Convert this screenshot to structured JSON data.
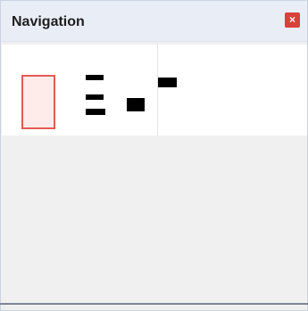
{
  "panel": {
    "title": "Navigation",
    "close_icon_glyph": "×",
    "accent_color": "#d9413b",
    "viewport_frame_color": "#e55a55"
  },
  "icons": {
    "close": "close-icon"
  }
}
